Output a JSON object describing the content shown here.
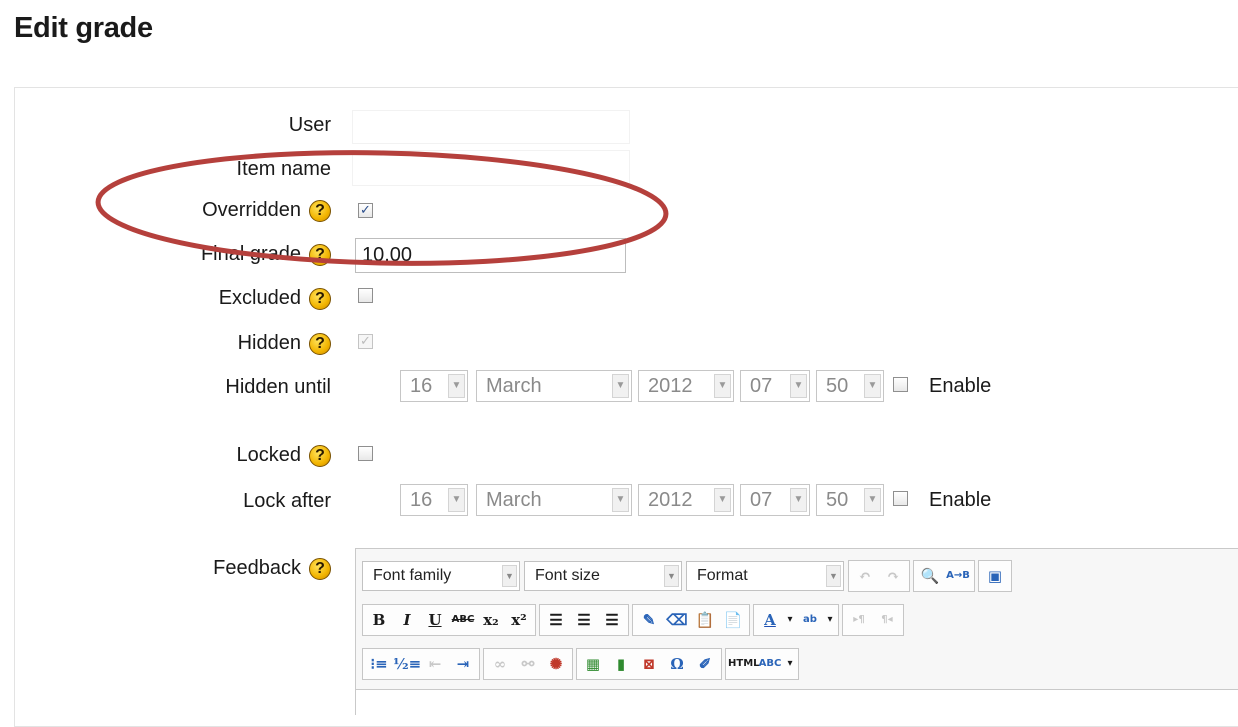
{
  "page": {
    "title": "Edit grade"
  },
  "form": {
    "user_label": "User",
    "user_value": "",
    "item_name_label": "Item name",
    "item_name_value": "",
    "overridden_label": "Overridden",
    "overridden_checked": true,
    "final_grade_label": "Final grade",
    "final_grade_value": "10.00",
    "excluded_label": "Excluded",
    "excluded_checked": false,
    "hidden_label": "Hidden",
    "hidden_checked": true,
    "hidden_until_label": "Hidden until",
    "hidden_until": {
      "day": "16",
      "month": "March",
      "year": "2012",
      "hour": "07",
      "minute": "50",
      "enable_label": "Enable",
      "enabled": false
    },
    "locked_label": "Locked",
    "locked_checked": false,
    "lock_after_label": "Lock after",
    "lock_after": {
      "day": "16",
      "month": "March",
      "year": "2012",
      "hour": "07",
      "minute": "50",
      "enable_label": "Enable",
      "enabled": false
    },
    "feedback_label": "Feedback",
    "help_icon": "help-icon",
    "help_glyph": "?"
  },
  "editor": {
    "font_family": "Font family",
    "font_size": "Font size",
    "format": "Format",
    "html_button": "HTML",
    "spell_button": "ABC"
  },
  "annotation": {
    "color": "#b5403c"
  }
}
